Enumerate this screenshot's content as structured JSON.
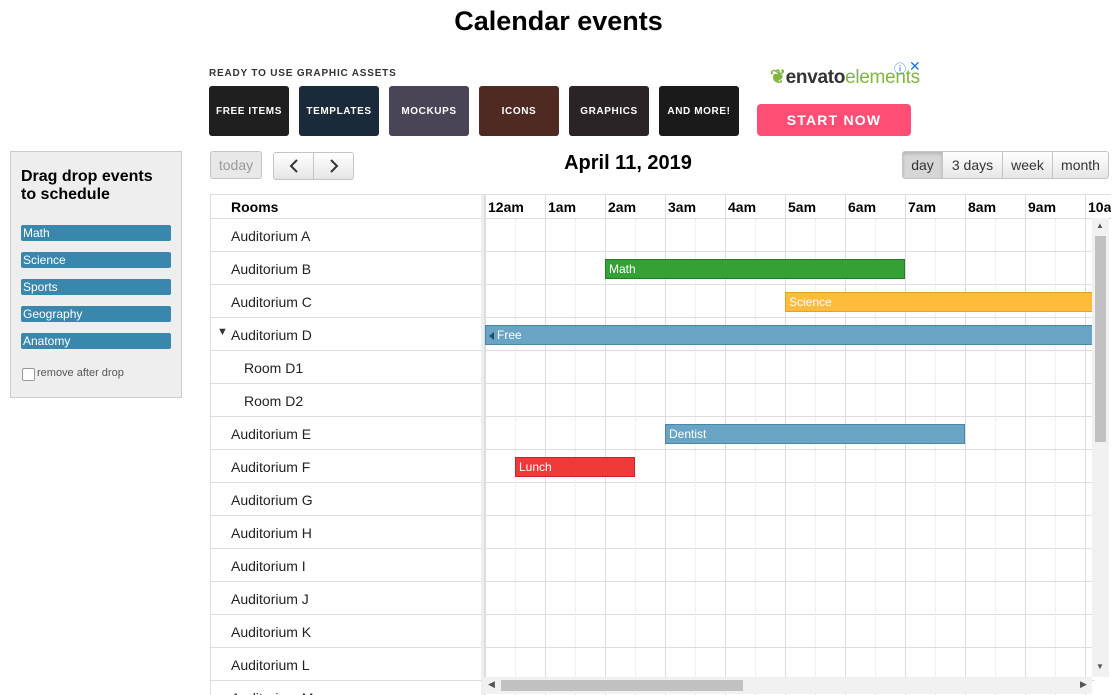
{
  "title": "Calendar events",
  "ad": {
    "heading": "READY TO USE GRAPHIC ASSETS",
    "tiles": [
      {
        "label": "FREE ITEMS",
        "bg": "#1f1f1f"
      },
      {
        "label": "TEMPLATES",
        "bg": "#1b2a3a"
      },
      {
        "label": "MOCKUPS",
        "bg": "#4a4457"
      },
      {
        "label": "ICONS",
        "bg": "#4e2a22"
      },
      {
        "label": "GRAPHICS",
        "bg": "#2a2426"
      },
      {
        "label": "AND MORE!",
        "bg": "#1a1a1a"
      }
    ],
    "logo_brand": "envato",
    "logo_sub": "elements",
    "info_icon": "ⓘ",
    "close_icon": "✕",
    "cta": "START NOW",
    "cta_color": "#ff4e74"
  },
  "external_events": {
    "title": "Drag drop events to schedule",
    "items": [
      "Math",
      "Science",
      "Sports",
      "Geography",
      "Anatomy"
    ],
    "remove_label": "remove after drop",
    "remove_checked": false,
    "color": "#3a87ad"
  },
  "toolbar": {
    "today": "today",
    "prev_icon": "chevron-left",
    "next_icon": "chevron-right",
    "date_title": "April 11, 2019",
    "views": [
      "day",
      "3 days",
      "week",
      "month"
    ],
    "active_view": "day"
  },
  "scheduler": {
    "resource_header": "Rooms",
    "time_slots": [
      "12am",
      "1am",
      "2am",
      "3am",
      "4am",
      "5am",
      "6am",
      "7am",
      "8am",
      "9am",
      "10a"
    ],
    "resources": [
      {
        "label": "Auditorium A",
        "level": 0
      },
      {
        "label": "Auditorium B",
        "level": 0
      },
      {
        "label": "Auditorium C",
        "level": 0
      },
      {
        "label": "Auditorium D",
        "level": 0,
        "expanded": true
      },
      {
        "label": "Room D1",
        "level": 1
      },
      {
        "label": "Room D2",
        "level": 1
      },
      {
        "label": "Auditorium E",
        "level": 0
      },
      {
        "label": "Auditorium F",
        "level": 0
      },
      {
        "label": "Auditorium G",
        "level": 0
      },
      {
        "label": "Auditorium H",
        "level": 0
      },
      {
        "label": "Auditorium I",
        "level": 0
      },
      {
        "label": "Auditorium J",
        "level": 0
      },
      {
        "label": "Auditorium K",
        "level": 0
      },
      {
        "label": "Auditorium L",
        "level": 0
      },
      {
        "label": "Auditorium M",
        "level": 0
      }
    ],
    "events": [
      {
        "title": "Math",
        "row": 1,
        "start": 2.0,
        "end": 7.0,
        "color": "#33a133",
        "border": "#267a26"
      },
      {
        "title": "Science",
        "row": 2,
        "start": 5.0,
        "end": 12.0,
        "color": "#ffbb3c",
        "border": "#e2a12c"
      },
      {
        "title": "Free",
        "row": 3,
        "start": -1.0,
        "end": 12.0,
        "color": "#6aa4c4",
        "border": "#4a86a8",
        "continues_left": true
      },
      {
        "title": "Dentist",
        "row": 6,
        "start": 3.0,
        "end": 8.0,
        "color": "#6aa4c4",
        "border": "#4a86a8"
      },
      {
        "title": "Lunch",
        "row": 7,
        "start": 0.5,
        "end": 2.5,
        "color": "#f03a3a",
        "border": "#c42727"
      }
    ]
  }
}
